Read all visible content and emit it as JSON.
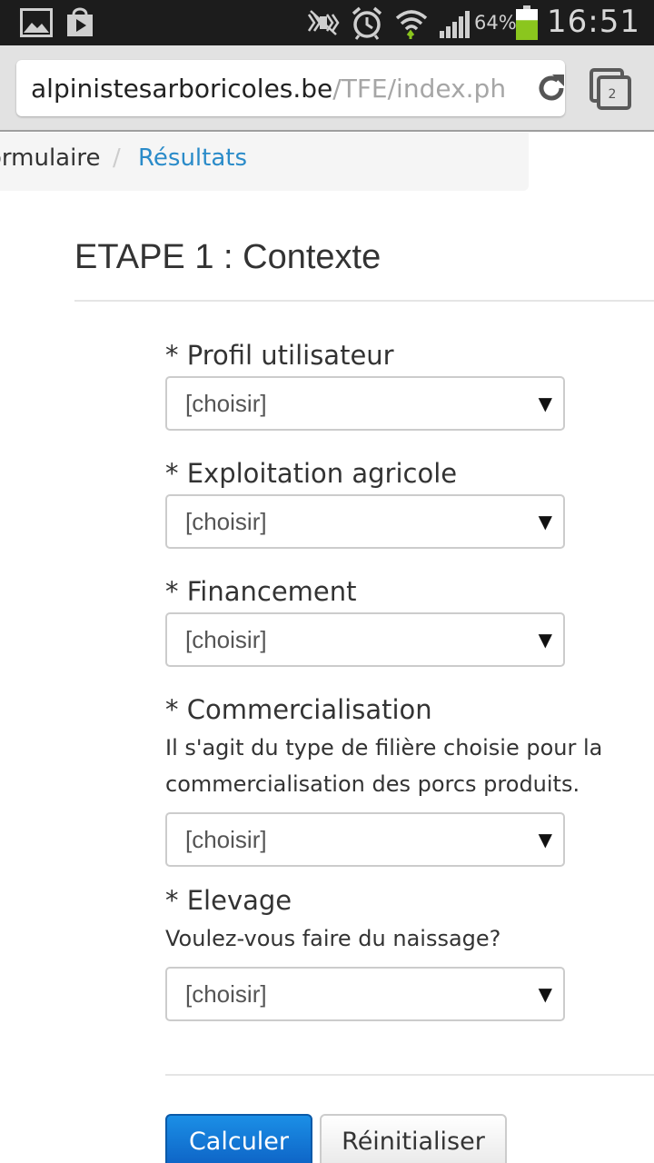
{
  "status_bar": {
    "battery": "64%",
    "battery_level": 0.64,
    "time": "16:51",
    "icons": [
      "gallery-icon",
      "play-store-icon",
      "mute-icon",
      "alarm-icon",
      "wifi-icon",
      "signal-icon",
      "battery-icon"
    ]
  },
  "browser": {
    "url_domain": "alpinistesarboricoles.be",
    "url_path": "/TFE/index.php",
    "tab_count": "2"
  },
  "breadcrumb": {
    "previous": "ormulaire",
    "separator": "/",
    "current": "Résultats"
  },
  "form": {
    "legend": "ETAPE 1 : Contexte",
    "fields": [
      {
        "label": "* Profil utilisateur",
        "help": "",
        "value": "[choisir]"
      },
      {
        "label": "* Exploitation agricole",
        "help": "",
        "value": "[choisir]"
      },
      {
        "label": "* Financement",
        "help": "",
        "value": "[choisir]"
      },
      {
        "label": "* Commercialisation",
        "help": "Il s'agit du type de filière choisie pour la commercialisation des porcs produits.",
        "value": "[choisir]"
      },
      {
        "label": "* Elevage",
        "help": "Voulez-vous faire du naissage?",
        "value": "[choisir]"
      }
    ],
    "submit_label": "Calculer",
    "reset_label": "Réinitialiser"
  },
  "colors": {
    "status_bar_bg": "#1c1c1c",
    "battery_green": "#8bc61e",
    "link_blue": "#2a8bc9",
    "primary_button": "#0d6fd0"
  }
}
